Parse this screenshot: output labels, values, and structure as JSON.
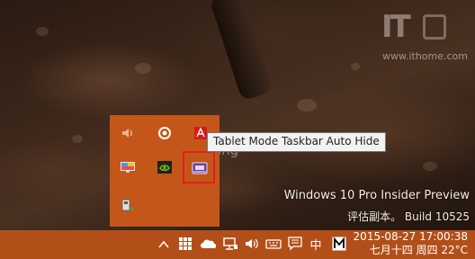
{
  "watermark": {
    "logo_text": "IT",
    "url": "www.ithome.com"
  },
  "desktop": {
    "build_line1": "Windows 10 Pro Insider Preview",
    "build_line2": "评估副本。 Build 10525",
    "ghost_text": "ing"
  },
  "tooltip": {
    "text": "Tablet Mode Taskbar Auto Hide"
  },
  "flyout": {
    "icons": [
      "volume-icon",
      "circle-app-icon",
      "adobe-icon",
      "display-icon",
      "nvidia-icon",
      "tablet-mode-icon",
      "safely-remove-icon"
    ],
    "highlight_color": "#e0201c"
  },
  "taskbar": {
    "color": "#b24f18",
    "ime_label": "中",
    "clock_time": "2015-08-27  17:00:38",
    "clock_date": "七月十四 周四 22°C"
  }
}
